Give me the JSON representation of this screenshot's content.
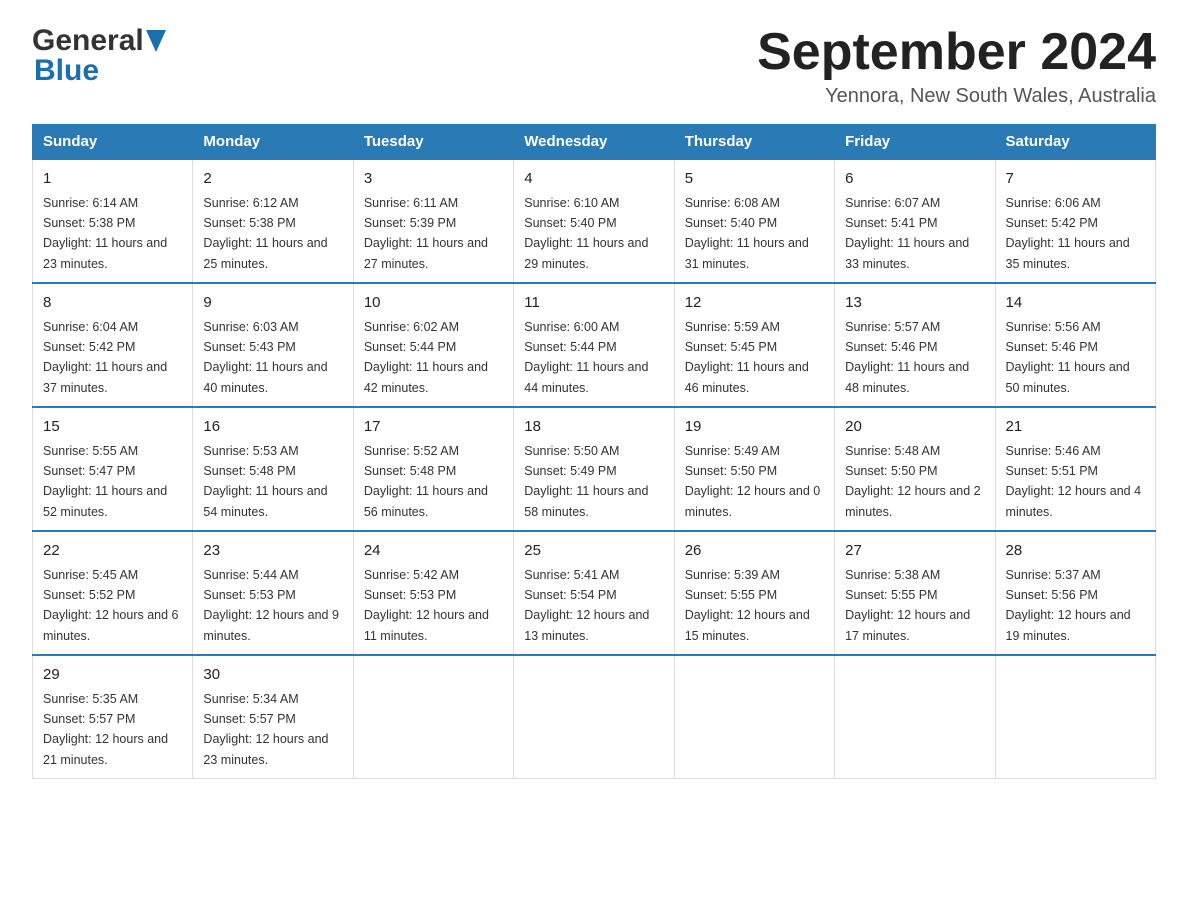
{
  "header": {
    "logo_general": "General",
    "logo_blue": "Blue",
    "title": "September 2024",
    "subtitle": "Yennora, New South Wales, Australia"
  },
  "weekdays": [
    "Sunday",
    "Monday",
    "Tuesday",
    "Wednesday",
    "Thursday",
    "Friday",
    "Saturday"
  ],
  "weeks": [
    [
      {
        "day": 1,
        "sunrise": "6:14 AM",
        "sunset": "5:38 PM",
        "daylight": "11 hours and 23 minutes."
      },
      {
        "day": 2,
        "sunrise": "6:12 AM",
        "sunset": "5:38 PM",
        "daylight": "11 hours and 25 minutes."
      },
      {
        "day": 3,
        "sunrise": "6:11 AM",
        "sunset": "5:39 PM",
        "daylight": "11 hours and 27 minutes."
      },
      {
        "day": 4,
        "sunrise": "6:10 AM",
        "sunset": "5:40 PM",
        "daylight": "11 hours and 29 minutes."
      },
      {
        "day": 5,
        "sunrise": "6:08 AM",
        "sunset": "5:40 PM",
        "daylight": "11 hours and 31 minutes."
      },
      {
        "day": 6,
        "sunrise": "6:07 AM",
        "sunset": "5:41 PM",
        "daylight": "11 hours and 33 minutes."
      },
      {
        "day": 7,
        "sunrise": "6:06 AM",
        "sunset": "5:42 PM",
        "daylight": "11 hours and 35 minutes."
      }
    ],
    [
      {
        "day": 8,
        "sunrise": "6:04 AM",
        "sunset": "5:42 PM",
        "daylight": "11 hours and 37 minutes."
      },
      {
        "day": 9,
        "sunrise": "6:03 AM",
        "sunset": "5:43 PM",
        "daylight": "11 hours and 40 minutes."
      },
      {
        "day": 10,
        "sunrise": "6:02 AM",
        "sunset": "5:44 PM",
        "daylight": "11 hours and 42 minutes."
      },
      {
        "day": 11,
        "sunrise": "6:00 AM",
        "sunset": "5:44 PM",
        "daylight": "11 hours and 44 minutes."
      },
      {
        "day": 12,
        "sunrise": "5:59 AM",
        "sunset": "5:45 PM",
        "daylight": "11 hours and 46 minutes."
      },
      {
        "day": 13,
        "sunrise": "5:57 AM",
        "sunset": "5:46 PM",
        "daylight": "11 hours and 48 minutes."
      },
      {
        "day": 14,
        "sunrise": "5:56 AM",
        "sunset": "5:46 PM",
        "daylight": "11 hours and 50 minutes."
      }
    ],
    [
      {
        "day": 15,
        "sunrise": "5:55 AM",
        "sunset": "5:47 PM",
        "daylight": "11 hours and 52 minutes."
      },
      {
        "day": 16,
        "sunrise": "5:53 AM",
        "sunset": "5:48 PM",
        "daylight": "11 hours and 54 minutes."
      },
      {
        "day": 17,
        "sunrise": "5:52 AM",
        "sunset": "5:48 PM",
        "daylight": "11 hours and 56 minutes."
      },
      {
        "day": 18,
        "sunrise": "5:50 AM",
        "sunset": "5:49 PM",
        "daylight": "11 hours and 58 minutes."
      },
      {
        "day": 19,
        "sunrise": "5:49 AM",
        "sunset": "5:50 PM",
        "daylight": "12 hours and 0 minutes."
      },
      {
        "day": 20,
        "sunrise": "5:48 AM",
        "sunset": "5:50 PM",
        "daylight": "12 hours and 2 minutes."
      },
      {
        "day": 21,
        "sunrise": "5:46 AM",
        "sunset": "5:51 PM",
        "daylight": "12 hours and 4 minutes."
      }
    ],
    [
      {
        "day": 22,
        "sunrise": "5:45 AM",
        "sunset": "5:52 PM",
        "daylight": "12 hours and 6 minutes."
      },
      {
        "day": 23,
        "sunrise": "5:44 AM",
        "sunset": "5:53 PM",
        "daylight": "12 hours and 9 minutes."
      },
      {
        "day": 24,
        "sunrise": "5:42 AM",
        "sunset": "5:53 PM",
        "daylight": "12 hours and 11 minutes."
      },
      {
        "day": 25,
        "sunrise": "5:41 AM",
        "sunset": "5:54 PM",
        "daylight": "12 hours and 13 minutes."
      },
      {
        "day": 26,
        "sunrise": "5:39 AM",
        "sunset": "5:55 PM",
        "daylight": "12 hours and 15 minutes."
      },
      {
        "day": 27,
        "sunrise": "5:38 AM",
        "sunset": "5:55 PM",
        "daylight": "12 hours and 17 minutes."
      },
      {
        "day": 28,
        "sunrise": "5:37 AM",
        "sunset": "5:56 PM",
        "daylight": "12 hours and 19 minutes."
      }
    ],
    [
      {
        "day": 29,
        "sunrise": "5:35 AM",
        "sunset": "5:57 PM",
        "daylight": "12 hours and 21 minutes."
      },
      {
        "day": 30,
        "sunrise": "5:34 AM",
        "sunset": "5:57 PM",
        "daylight": "12 hours and 23 minutes."
      },
      null,
      null,
      null,
      null,
      null
    ]
  ]
}
